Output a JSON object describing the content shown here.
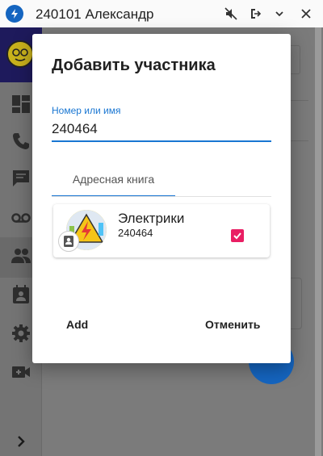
{
  "window": {
    "title": "240101 Александр",
    "app_icon": "lightning-icon",
    "controls": [
      "mute-icon",
      "logout-icon",
      "chevron-down-icon",
      "close-icon"
    ]
  },
  "sidebar": {
    "items": [
      {
        "icon": "dashboard-icon"
      },
      {
        "icon": "phone-icon"
      },
      {
        "icon": "chat-icon"
      },
      {
        "icon": "voicemail-icon"
      },
      {
        "icon": "contacts-icon",
        "active": true
      },
      {
        "icon": "calendar-contact-icon"
      },
      {
        "icon": "settings-icon"
      },
      {
        "icon": "video-icon"
      }
    ],
    "expand_icon": "chevron-right-icon"
  },
  "dialog": {
    "title": "Добавить участника",
    "field_label": "Номер или имя",
    "field_value": "240464",
    "tab_label": "Адресная книга",
    "contacts": [
      {
        "name": "Электрики",
        "number": "240464",
        "checked": true
      }
    ],
    "add_label": "Add",
    "cancel_label": "Отменить"
  },
  "colors": {
    "accent": "#1976d2",
    "checkbox": "#e91e63",
    "fab": "#1565c0"
  }
}
